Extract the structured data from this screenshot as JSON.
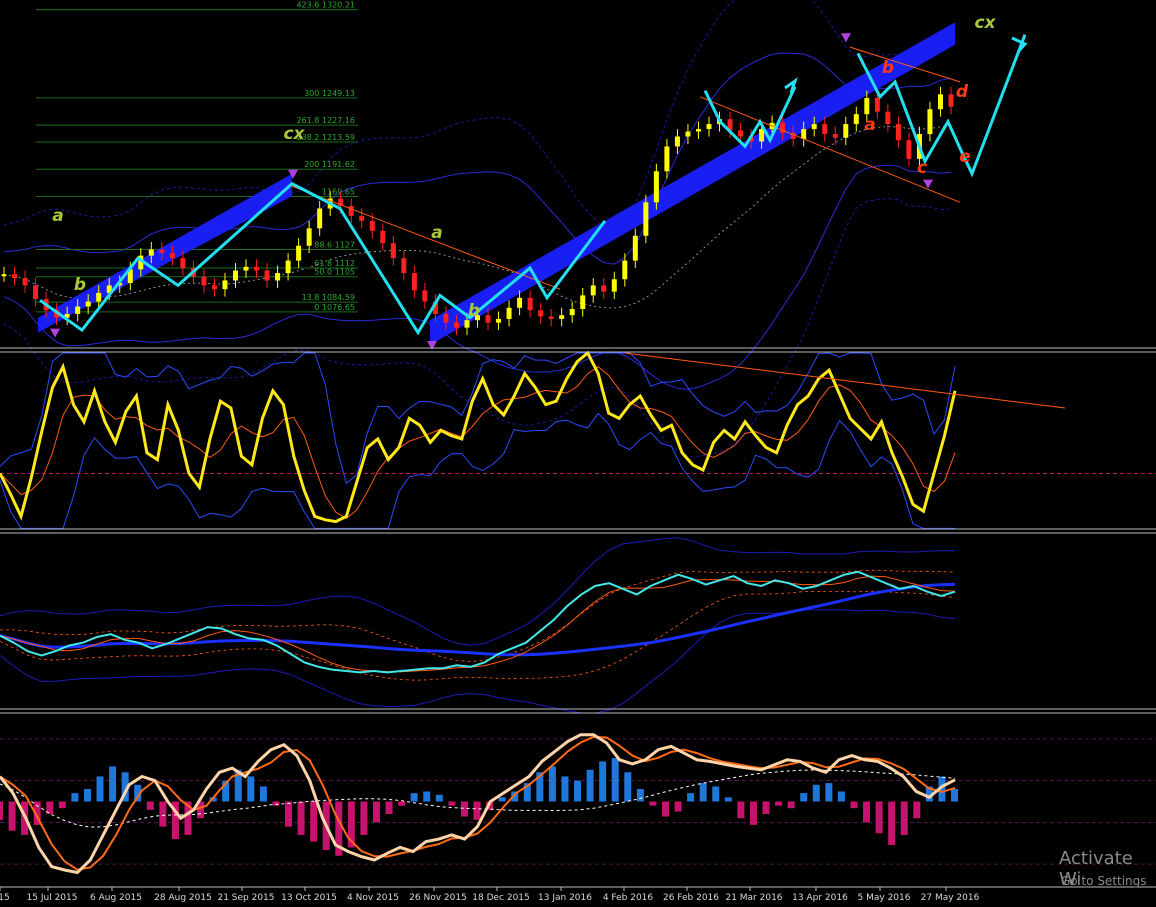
{
  "chart_data": [
    {
      "type": "line",
      "panel": "price",
      "subtype": "candlestick with elliott wave annotations",
      "colors": {
        "background": "#000000",
        "bull": "#ffff00",
        "bear": "#ff2020",
        "wave": "#22e0f0",
        "channel": "#1a20ff",
        "envelope": "#1a1aa0"
      },
      "close_series": [
        1107,
        1104,
        1098,
        1087,
        1078,
        1072,
        1075,
        1081,
        1085,
        1092,
        1098,
        1100,
        1111,
        1122,
        1127,
        1124,
        1120,
        1112,
        1105,
        1098,
        1095,
        1102,
        1110,
        1113,
        1110,
        1102,
        1108,
        1118,
        1130,
        1144,
        1160,
        1168,
        1162,
        1154,
        1150,
        1142,
        1132,
        1120,
        1108,
        1094,
        1085,
        1075,
        1068,
        1064,
        1070,
        1074,
        1068,
        1071,
        1080,
        1088,
        1078,
        1073,
        1071,
        1074,
        1079,
        1090,
        1098,
        1093,
        1103,
        1118,
        1138,
        1165,
        1190,
        1210,
        1218,
        1222,
        1224,
        1228,
        1232,
        1223,
        1218,
        1214,
        1224,
        1229,
        1221,
        1216,
        1224,
        1228,
        1220,
        1217,
        1228,
        1236,
        1249,
        1238,
        1228,
        1215,
        1200,
        1220,
        1240,
        1252,
        1242
      ],
      "price_scale_note": "right axis not visible; values inferred from fibonacci label prices",
      "fibonacci_levels": [
        {
          "label": "423.6 1320.21",
          "level": 423.6,
          "price": 1320.21
        },
        {
          "label": "300 1249.13",
          "level": 300,
          "price": 1249.13
        },
        {
          "label": "261.8 1227.16",
          "level": 261.8,
          "price": 1227.16
        },
        {
          "label": "238.2 1213.59",
          "level": 238.2,
          "price": 1213.59
        },
        {
          "label": "200 1191.62",
          "level": 200,
          "price": 1191.62
        },
        {
          "label": "1169.65",
          "level": 161.8,
          "price": 1169.65
        },
        {
          "label": "88.6 1127",
          "level": 88.6,
          "price": 1127
        },
        {
          "label": "61.8 1112",
          "level": 61.8,
          "price": 1112
        },
        {
          "label": "50.0 1105",
          "level": 50,
          "price": 1105
        },
        {
          "label": "13.8 1084.59",
          "level": 13.8,
          "price": 1084.59
        },
        {
          "label": "0 1076.65",
          "level": 0,
          "price": 1076.65
        }
      ],
      "wave_labels": [
        {
          "text": "a",
          "color": "#a8c83c"
        },
        {
          "text": "b",
          "color": "#a8c83c"
        },
        {
          "text": "cx",
          "color": "#a8c83c"
        },
        {
          "text": "a",
          "color": "#a8c83c"
        },
        {
          "text": "b",
          "color": "#a8c83c"
        },
        {
          "text": "b",
          "color": "#ff3a14"
        },
        {
          "text": "a",
          "color": "#ff3a14"
        },
        {
          "text": "c",
          "color": "#ff3a14"
        },
        {
          "text": "d",
          "color": "#ff3a14"
        },
        {
          "text": "e",
          "color": "#ff3a14"
        },
        {
          "text": "cx",
          "color": "#a8c83c"
        }
      ]
    },
    {
      "type": "line",
      "panel": "oscillator-1",
      "colors": {
        "main": "#ffe81a",
        "signal": "#ff5a14",
        "band": "#2a4aff",
        "trend": "#ff5a14",
        "midline": "#ff2080"
      },
      "values": [
        30,
        18,
        5,
        28,
        55,
        80,
        92,
        70,
        60,
        78,
        60,
        48,
        66,
        75,
        42,
        38,
        70,
        55,
        30,
        22,
        50,
        72,
        68,
        40,
        35,
        62,
        78,
        70,
        40,
        20,
        5,
        3,
        2,
        5,
        25,
        45,
        50,
        38,
        45,
        62,
        58,
        48,
        55,
        52,
        50,
        72,
        85,
        70,
        64,
        75,
        88,
        80,
        70,
        72,
        85,
        95,
        100,
        88,
        65,
        62,
        70,
        75,
        64,
        55,
        58,
        42,
        35,
        32,
        48,
        55,
        50,
        60,
        52,
        45,
        42,
        58,
        70,
        75,
        85,
        90,
        76,
        62,
        56,
        50,
        60,
        42,
        28,
        12,
        8,
        30,
        52,
        78
      ],
      "ylim": [
        0,
        100
      ]
    },
    {
      "type": "line",
      "panel": "oscillator-2",
      "colors": {
        "main": "#40e8e8",
        "signal": "#ff5a14",
        "long_ma": "#1a30ff",
        "band": "#1a1ab8"
      },
      "values": [
        49,
        44,
        38,
        35,
        38,
        42,
        44,
        48,
        50,
        46,
        44,
        40,
        43,
        47,
        51,
        55,
        54,
        50,
        47,
        46,
        42,
        36,
        30,
        27,
        25,
        24,
        23,
        24,
        23,
        24,
        25,
        26,
        26,
        28,
        27,
        30,
        36,
        40,
        44,
        52,
        60,
        70,
        78,
        84,
        86,
        82,
        78,
        84,
        88,
        92,
        89,
        85,
        88,
        91,
        86,
        84,
        88,
        86,
        82,
        84,
        88,
        92,
        94,
        90,
        86,
        82,
        84,
        80,
        77,
        80
      ],
      "ylim": [
        0,
        120
      ]
    },
    {
      "type": "bar",
      "panel": "oscillator-3",
      "colors": {
        "positive": "#1e78dc",
        "negative": "#c8136e",
        "line": "#ffd4a8",
        "signal": "#ff6a14",
        "dashed": "#ffffff",
        "grid": "#6a1a6a"
      },
      "histogram": [
        -22,
        -35,
        -40,
        -28,
        -15,
        -8,
        10,
        15,
        30,
        42,
        35,
        20,
        -10,
        -30,
        -45,
        -40,
        -20,
        5,
        25,
        38,
        30,
        18,
        -5,
        -30,
        -40,
        -48,
        -58,
        -65,
        -55,
        -40,
        -25,
        -15,
        -5,
        10,
        12,
        8,
        -5,
        -18,
        -22,
        -10,
        5,
        12,
        22,
        35,
        42,
        30,
        25,
        38,
        48,
        52,
        35,
        15,
        -5,
        -18,
        -12,
        10,
        22,
        18,
        5,
        -20,
        -28,
        -15,
        -5,
        -8,
        10,
        20,
        22,
        12,
        -8,
        -25,
        -38,
        -52,
        -40,
        -20,
        18,
        30,
        15
      ],
      "line": [
        30,
        10,
        -20,
        -55,
        -78,
        -82,
        -85,
        -70,
        -40,
        -10,
        20,
        30,
        25,
        0,
        -20,
        -10,
        15,
        35,
        40,
        30,
        48,
        62,
        68,
        55,
        25,
        -20,
        -52,
        -60,
        -66,
        -70,
        -62,
        -55,
        -60,
        -48,
        -45,
        -40,
        -45,
        -30,
        0,
        10,
        20,
        30,
        48,
        60,
        72,
        80,
        80,
        70,
        50,
        45,
        50,
        62,
        66,
        58,
        50,
        48,
        45,
        42,
        40,
        38,
        44,
        50,
        48,
        40,
        35,
        50,
        55,
        50,
        48,
        40,
        30,
        12,
        5,
        18,
        26
      ],
      "ylim": [
        -100,
        100
      ]
    }
  ],
  "x_axis": {
    "tick_labels": [
      "15",
      "15 Jul 2015",
      "6 Aug 2015",
      "28 Aug 2015",
      "21 Sep 2015",
      "13 Oct 2015",
      "4 Nov 2015",
      "26 Nov 2015",
      "18 Dec 2015",
      "13 Jan 2016",
      "4 Feb 2016",
      "26 Feb 2016",
      "21 Mar 2016",
      "13 Apr 2016",
      "5 May 2016",
      "27 May 2016"
    ]
  },
  "watermark": {
    "line1": "Activate Wi",
    "line2": "Go to Settings"
  }
}
